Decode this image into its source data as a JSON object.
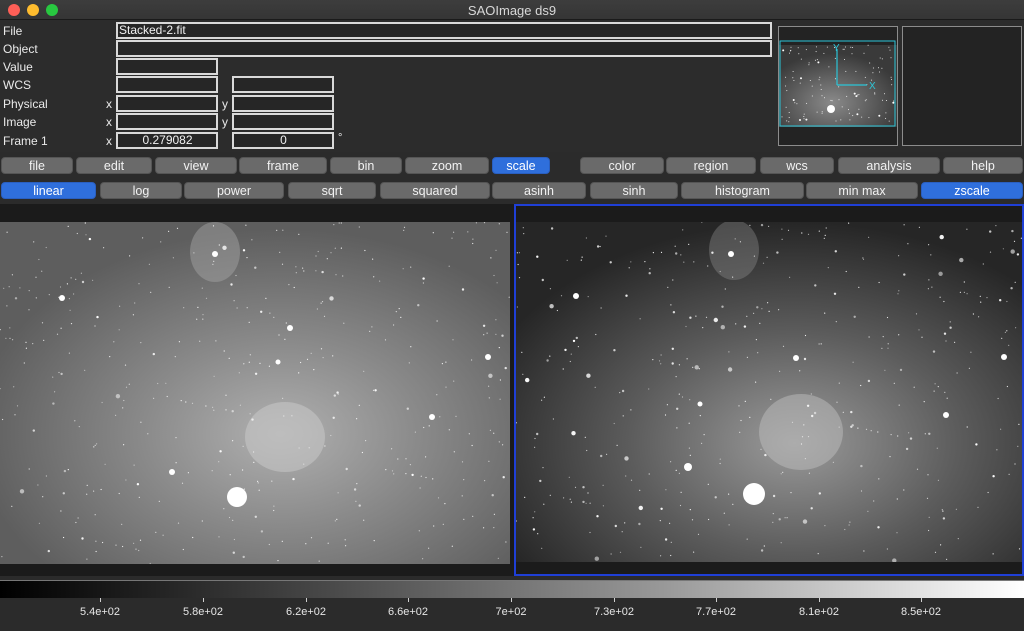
{
  "window": {
    "title": "SAOImage ds9"
  },
  "info": {
    "file_label": "File",
    "file_value": "Stacked-2.fit",
    "object_label": "Object",
    "object_value": "",
    "value_label": "Value",
    "value_value": "",
    "wcs_label": "WCS",
    "wcs_value1": "",
    "wcs_value2": "",
    "physical_label": "Physical",
    "physical_x_axis": "x",
    "physical_x": "",
    "physical_y_axis": "y",
    "physical_y": "",
    "image_label": "Image",
    "image_x_axis": "x",
    "image_x": "",
    "image_y_axis": "y",
    "image_y": "",
    "frame_label": "Frame 1",
    "frame_axis": "x",
    "frame_zoom": "0.279082",
    "frame_angle": "0",
    "degree": "°"
  },
  "panner": {
    "y_label": "Y",
    "x_label": "X",
    "accent": "#2bc5d8"
  },
  "menu": {
    "items": [
      "file",
      "edit",
      "view",
      "frame",
      "bin",
      "zoom",
      "scale",
      "color",
      "region",
      "wcs",
      "analysis",
      "help"
    ],
    "active": "scale"
  },
  "scale_buttons": {
    "items": [
      "linear",
      "log",
      "power",
      "sqrt",
      "squared",
      "asinh",
      "sinh",
      "histogram",
      "min max",
      "zscale"
    ],
    "active": [
      "linear",
      "zscale"
    ]
  },
  "colorbar": {
    "ticks": [
      "5.4e+02",
      "5.8e+02",
      "6.2e+02",
      "6.6e+02",
      "7e+02",
      "7.3e+02",
      "7.7e+02",
      "8.1e+02",
      "8.5e+02"
    ]
  },
  "colors": {
    "accent": "#2f6fdc",
    "frame_border": "#1f3fd6"
  }
}
